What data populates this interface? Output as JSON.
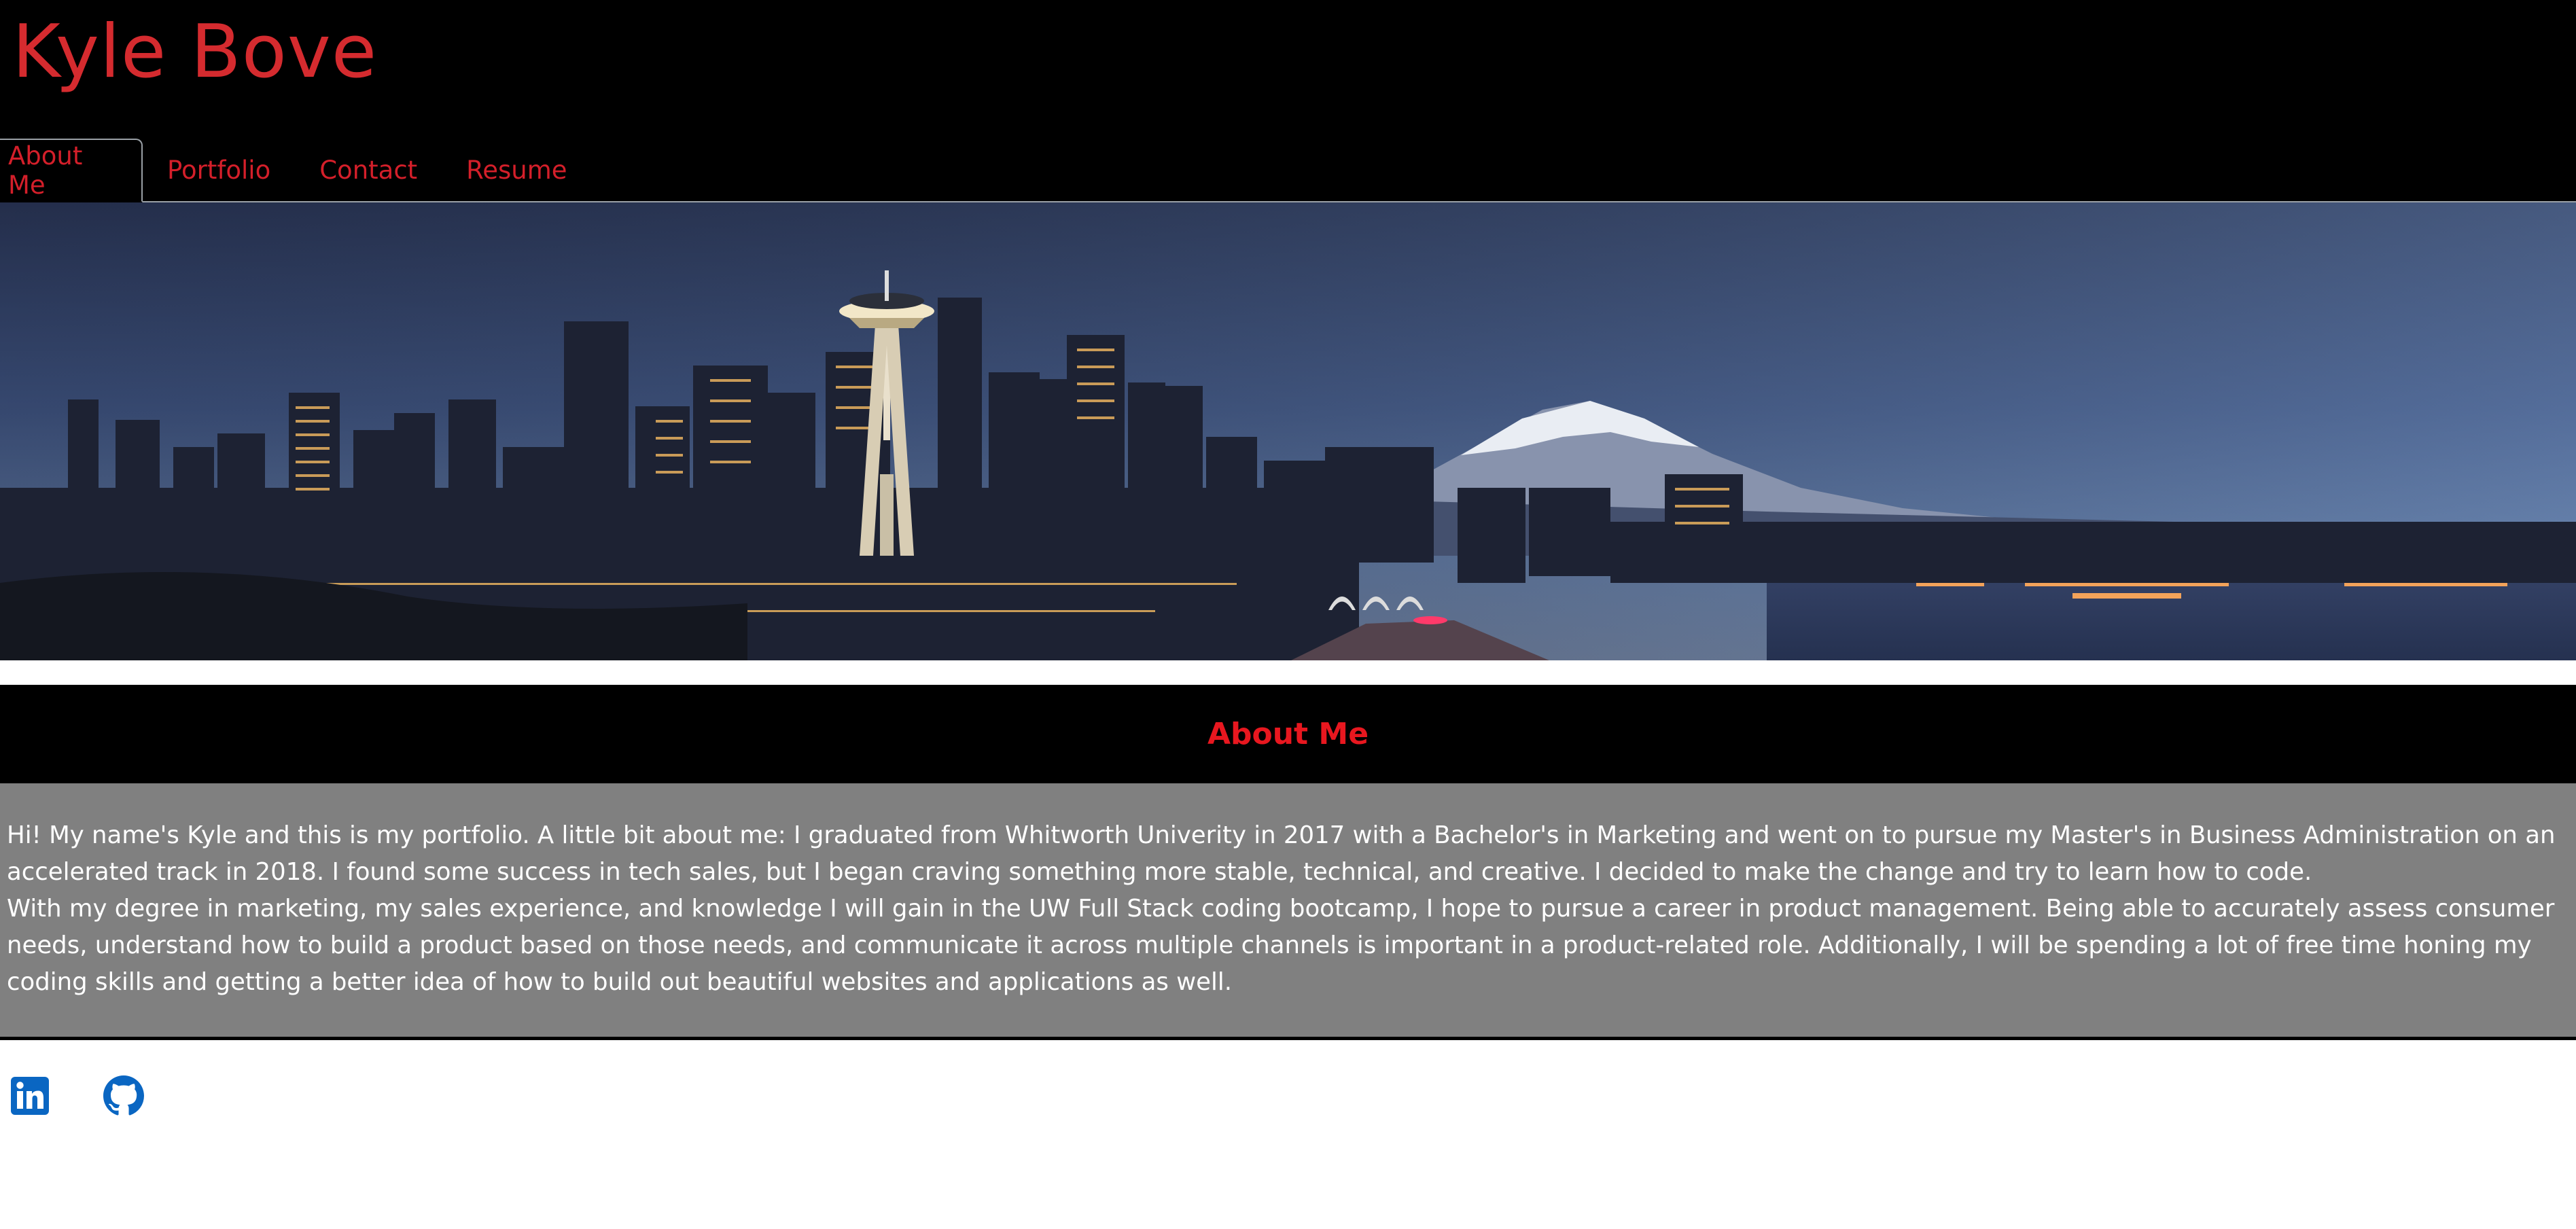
{
  "header": {
    "title": "Kyle Bove"
  },
  "nav": {
    "tabs": [
      {
        "label": "About Me",
        "active": true
      },
      {
        "label": "Portfolio",
        "active": false
      },
      {
        "label": "Contact",
        "active": false
      },
      {
        "label": "Resume",
        "active": false
      }
    ]
  },
  "about": {
    "heading": "About Me",
    "paragraphs": [
      "Hi! My name's Kyle and this is my portfolio. A little bit about me: I graduated from Whitworth Univerity in 2017 with a Bachelor's in Marketing and went on to pursue my Master's in Business Administration on an accelerated track in 2018. I found some success in tech sales, but I began craving something more stable, technical, and creative. I decided to make the change and try to learn how to code.",
      "With my degree in marketing, my sales experience, and knowledge I will gain in the UW Full Stack coding bootcamp, I hope to pursue a career in product management. Being able to accurately assess consumer needs, understand how to build a product based on those needs, and communicate it across multiple channels is important in a product-related role. Additionally, I will be spending a lot of free time honing my coding skills and getting a better idea of how to build out beautiful websites and applications as well."
    ]
  },
  "social": {
    "icons": [
      "linkedin-icon",
      "github-icon"
    ],
    "icon_color": "#0a66c2"
  },
  "colors": {
    "accent": "#d41f2a",
    "header_bg": "#000000",
    "about_bg": "#808080"
  }
}
